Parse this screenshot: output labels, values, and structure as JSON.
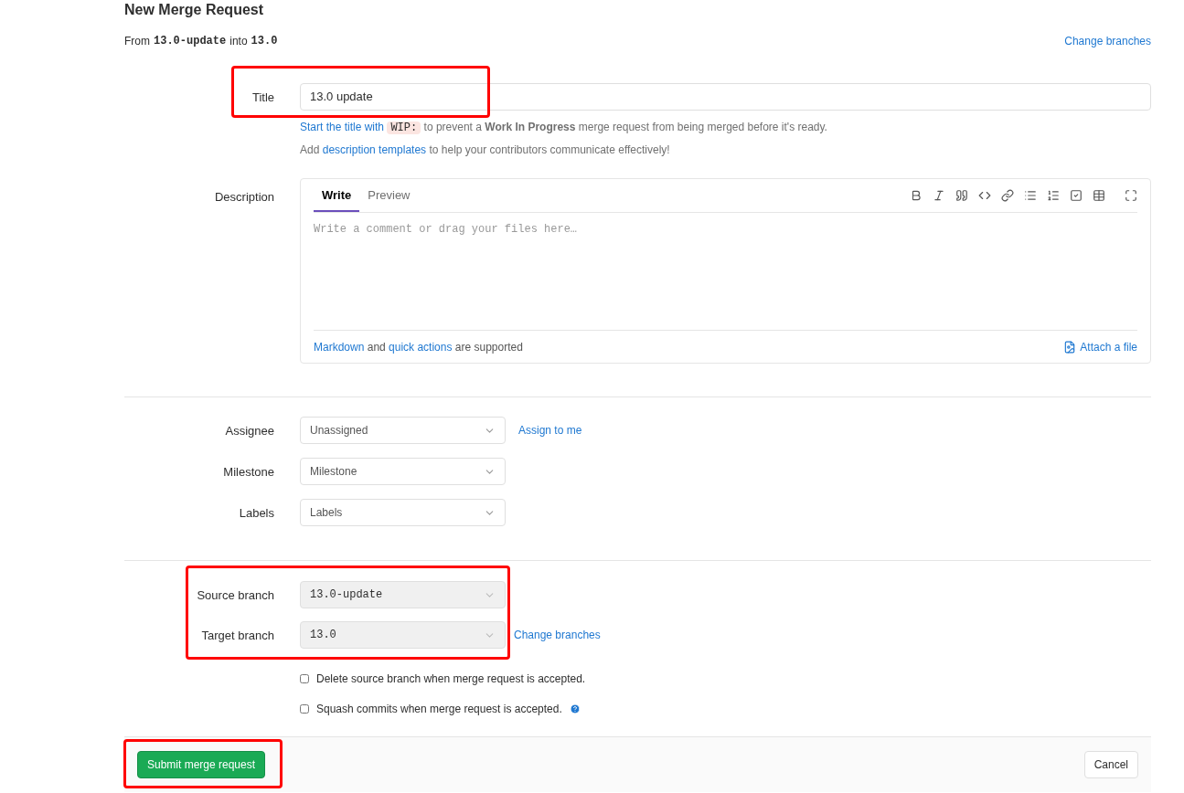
{
  "heading": "New Merge Request",
  "from_line": {
    "prefix": "From",
    "source": "13.0-update",
    "middle": "into",
    "target": "13.0",
    "link": "Change branches"
  },
  "title_field": {
    "label": "Title",
    "value": "13.0 update",
    "highlighted": true,
    "hint_link": "Start the title with",
    "hint_code": "WIP:",
    "hint_rest": "to prevent a **Work In Progress** merge request from being merged before it's ready.",
    "templates_prefix": "Add",
    "templates_link": "description templates",
    "templates_rest": "to help your contributors communicate effectively!"
  },
  "description": {
    "label": "Description",
    "tabs": [
      {
        "label": "Write",
        "selected": true
      },
      {
        "label": "Preview",
        "selected": false
      }
    ],
    "placeholder": "Write a comment or drag your files here…",
    "footer_link1": "Markdown",
    "footer_mid": "and",
    "footer_link2": "quick actions",
    "footer_rest": "are supported",
    "attach": "Attach a file"
  },
  "selects": [
    {
      "label": "Assignee",
      "value": "Unassigned",
      "action": "Assign to me"
    },
    {
      "label": "Milestone",
      "value": "Milestone"
    },
    {
      "label": "Labels",
      "value": "Labels"
    }
  ],
  "branches": {
    "highlighted": true,
    "source_label": "Source branch",
    "source": "13.0-update",
    "target_label": "Target branch",
    "target": "13.0",
    "link": "Change branches"
  },
  "options": [
    {
      "label": "Delete source branch when merge request is accepted.",
      "checked": false,
      "help": false
    },
    {
      "label": "Squash commits when merge request is accepted.",
      "checked": false,
      "help": true
    }
  ],
  "footer": {
    "submit": "Submit merge request",
    "cancel": "Cancel",
    "highlighted": true
  }
}
